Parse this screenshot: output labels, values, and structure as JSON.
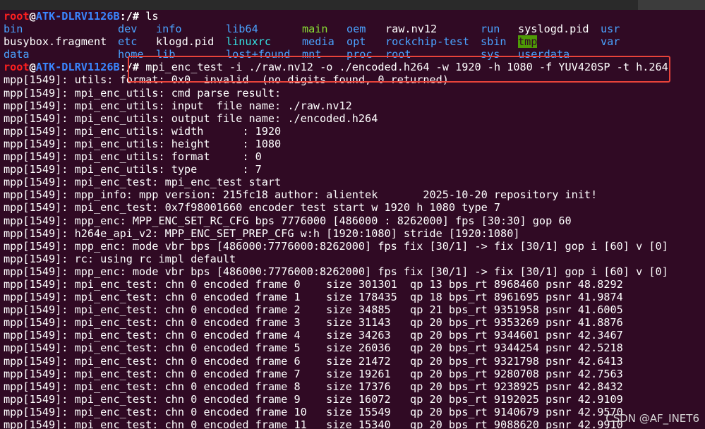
{
  "prompt": {
    "user": "root",
    "at": "@",
    "host": "ATK-DLRV1126B",
    "path": ":/#"
  },
  "commands": {
    "ls": " ls",
    "mpi": " mpi_enc_test -i ./raw.nv12 -o ./encoded.h264 -w 1920 -h 1080 -f YUV420SP -t h.264"
  },
  "ls_rows": [
    [
      {
        "text": "bin",
        "kind": "c-dir"
      },
      {
        "text": "dev",
        "kind": "c-dir"
      },
      {
        "text": "info",
        "kind": "c-dir"
      },
      {
        "text": "lib64",
        "kind": "c-dir"
      },
      {
        "text": "main",
        "kind": "c-exec"
      },
      {
        "text": "oem",
        "kind": "c-dir"
      },
      {
        "text": "raw.nv12",
        "kind": "c-file"
      },
      {
        "text": "run",
        "kind": "c-dir"
      },
      {
        "text": "syslogd.pid",
        "kind": "c-file"
      },
      {
        "text": "usr",
        "kind": "c-dir"
      }
    ],
    [
      {
        "text": "busybox.fragment",
        "kind": "c-file"
      },
      {
        "text": "etc",
        "kind": "c-dir"
      },
      {
        "text": "klogd.pid",
        "kind": "c-file"
      },
      {
        "text": "linuxrc",
        "kind": "c-link"
      },
      {
        "text": "media",
        "kind": "c-dir"
      },
      {
        "text": "opt",
        "kind": "c-dir"
      },
      {
        "text": "rockchip-test",
        "kind": "c-dir"
      },
      {
        "text": "sbin",
        "kind": "c-dir"
      },
      {
        "text": "tmp",
        "kind": "c-tmp"
      },
      {
        "text": "var",
        "kind": "c-dir"
      }
    ],
    [
      {
        "text": "data",
        "kind": "c-dir"
      },
      {
        "text": "home",
        "kind": "c-dir"
      },
      {
        "text": "lib",
        "kind": "c-dir"
      },
      {
        "text": "lost+found",
        "kind": "c-dir"
      },
      {
        "text": "mnt",
        "kind": "c-dir"
      },
      {
        "text": "proc",
        "kind": "c-dir"
      },
      {
        "text": "root",
        "kind": "c-dir"
      },
      {
        "text": "sys",
        "kind": "c-dir"
      },
      {
        "text": "userdata",
        "kind": "c-dir"
      }
    ]
  ],
  "output_lines": [
    "mpp[1549]: utils: format: 0x0  invalid  (no digits found, 0 returned)",
    "mpp[1549]: mpi_enc_utils: cmd parse result:",
    "mpp[1549]: mpi_enc_utils: input  file name: ./raw.nv12",
    "mpp[1549]: mpi_enc_utils: output file name: ./encoded.h264",
    "mpp[1549]: mpi_enc_utils: width      : 1920",
    "mpp[1549]: mpi_enc_utils: height     : 1080",
    "mpp[1549]: mpi_enc_utils: format     : 0",
    "mpp[1549]: mpi_enc_utils: type       : 7",
    "mpp[1549]: mpi_enc_test: mpi_enc_test start",
    "mpp[1549]: mpp_info: mpp version: 215fc18 author: alientek       2025-10-20 repository init!",
    "mpp[1549]: mpi_enc_test: 0x7f98001660 encoder test start w 1920 h 1080 type 7",
    "mpp[1549]: mpp_enc: MPP_ENC_SET_RC_CFG bps 7776000 [486000 : 8262000] fps [30:30] gop 60",
    "mpp[1549]: h264e_api_v2: MPP_ENC_SET_PREP_CFG w:h [1920:1080] stride [1920:1080]",
    "mpp[1549]: mpp_enc: mode vbr bps [486000:7776000:8262000] fps fix [30/1] -> fix [30/1] gop i [60] v [0]",
    "mpp[1549]: rc: using rc impl default",
    "mpp[1549]: mpp_enc: mode vbr bps [486000:7776000:8262000] fps fix [30/1] -> fix [30/1] gop i [60] v [0]",
    "mpp[1549]: mpi_enc_test: chn 0 encoded frame 0    size 301301  qp 13 bps_rt 8968460 psnr 48.8292",
    "mpp[1549]: mpi_enc_test: chn 0 encoded frame 1    size 178435  qp 18 bps_rt 8961695 psnr 41.9874",
    "mpp[1549]: mpi_enc_test: chn 0 encoded frame 2    size 34885   qp 21 bps_rt 9351958 psnr 41.6005",
    "mpp[1549]: mpi_enc_test: chn 0 encoded frame 3    size 31143   qp 20 bps_rt 9353269 psnr 41.8876",
    "mpp[1549]: mpi_enc_test: chn 0 encoded frame 4    size 34263   qp 20 bps_rt 9344601 psnr 42.3467",
    "mpp[1549]: mpi_enc_test: chn 0 encoded frame 5    size 26036   qp 20 bps_rt 9344254 psnr 42.5218",
    "mpp[1549]: mpi_enc_test: chn 0 encoded frame 6    size 21472   qp 20 bps_rt 9321798 psnr 42.6413",
    "mpp[1549]: mpi_enc_test: chn 0 encoded frame 7    size 19261   qp 20 bps_rt 9280708 psnr 42.7563",
    "mpp[1549]: mpi_enc_test: chn 0 encoded frame 8    size 17376   qp 20 bps_rt 9238925 psnr 42.8432",
    "mpp[1549]: mpi_enc_test: chn 0 encoded frame 9    size 16072   qp 20 bps_rt 9192025 psnr 42.9109",
    "mpp[1549]: mpi_enc_test: chn 0 encoded frame 10   size 15549   qp 20 bps_rt 9140679 psnr 42.9570",
    "mpp[1549]: mpi_enc_test: chn 0 encoded frame 11   size 15340   qp 20 bps_rt 9088620 psnr 42.9910"
  ],
  "watermark": "CSDN @AF_INET6",
  "colors": {
    "background": "#300a24",
    "prompt_user": "#ff2020",
    "prompt_host": "#3a86ff",
    "directory": "#4aa3ff",
    "executable": "#8ae234",
    "symlink": "#34e2e2",
    "highlight_box": "#e8433a"
  }
}
